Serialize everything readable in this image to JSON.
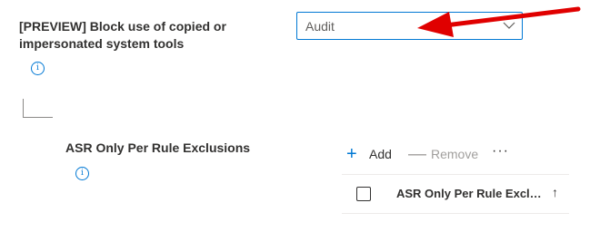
{
  "setting": {
    "label": "[PREVIEW] Block use of copied or impersonated system tools",
    "info_glyph": "i",
    "dropdown_value": "Audit"
  },
  "annotation": {
    "arrow_color": "#e00000"
  },
  "exclusions": {
    "label": "ASR Only Per Rule Exclusions",
    "info_glyph": "i",
    "toolbar": {
      "add_icon": "+",
      "add_label": "Add",
      "remove_icon": "—",
      "remove_label": "Remove",
      "more_label": "···"
    },
    "grid": {
      "column_header": "ASR Only Per Rule Exclusi...",
      "sort_icon": "↑"
    }
  },
  "colors": {
    "accent": "#0078d4",
    "text": "#323130",
    "disabled": "#a19f9d"
  }
}
